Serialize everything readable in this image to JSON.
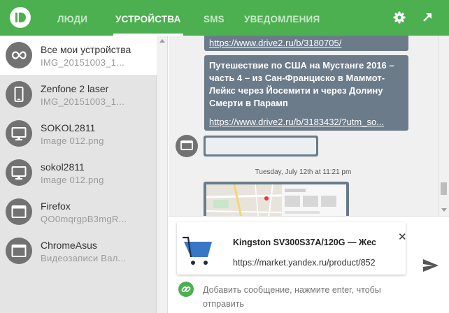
{
  "header": {
    "tabs": [
      {
        "label": "ЛЮДИ",
        "active": false
      },
      {
        "label": "УСТРОЙСТВА",
        "active": true
      },
      {
        "label": "SMS",
        "active": false
      },
      {
        "label": "УВЕДОМЛЕНИЯ",
        "active": false
      }
    ],
    "icons": [
      "pushbullet-logo-icon",
      "gear-icon",
      "expand-arrow-icon"
    ]
  },
  "devices": [
    {
      "name": "Все мои устройства",
      "subtitle": "IMG_20151003_1...",
      "icon": "infinity-icon",
      "active": true
    },
    {
      "name": "Zenfone 2 laser",
      "subtitle": "IMG_20151003_1...",
      "icon": "phone-icon",
      "active": false
    },
    {
      "name": "SOKOL2811",
      "subtitle": "Image 012.png",
      "icon": "desktop-icon",
      "active": false
    },
    {
      "name": "sokol2811",
      "subtitle": "Image 012.png",
      "icon": "desktop-icon",
      "active": false
    },
    {
      "name": "Firefox",
      "subtitle": "QO0mqrgpB3mgR...",
      "icon": "browser-icon",
      "active": false
    },
    {
      "name": "ChromeAsus",
      "subtitle": "Видеозаписи Вал...",
      "icon": "browser-icon",
      "active": false
    }
  ],
  "chat": {
    "link_top": "https://www.drive2.ru/b/3180705/",
    "article_title": "Путешествие по США на Мустанге 2016 – часть 4 – из Сан-Франциско в Маммот-Лейкс через Йосемити и через Долину Смерти в Парамп",
    "article_link": "https://www.drive2.ru/b/3183432/?utm_so...",
    "timestamp": "Tuesday, July 12th at 11:21 pm"
  },
  "compose": {
    "card_title": "Kingston SV300S37A/120G — Жес",
    "card_url": "https://market.yandex.ru/product/852",
    "placeholder": "Добавить сообщение, нажмите enter, чтобы отправить"
  },
  "colors": {
    "primary": "#4caf50",
    "bubble": "#6b7b8a",
    "sidebar_bg": "#e4e4e4",
    "chat_bg": "#f0f0f0"
  }
}
